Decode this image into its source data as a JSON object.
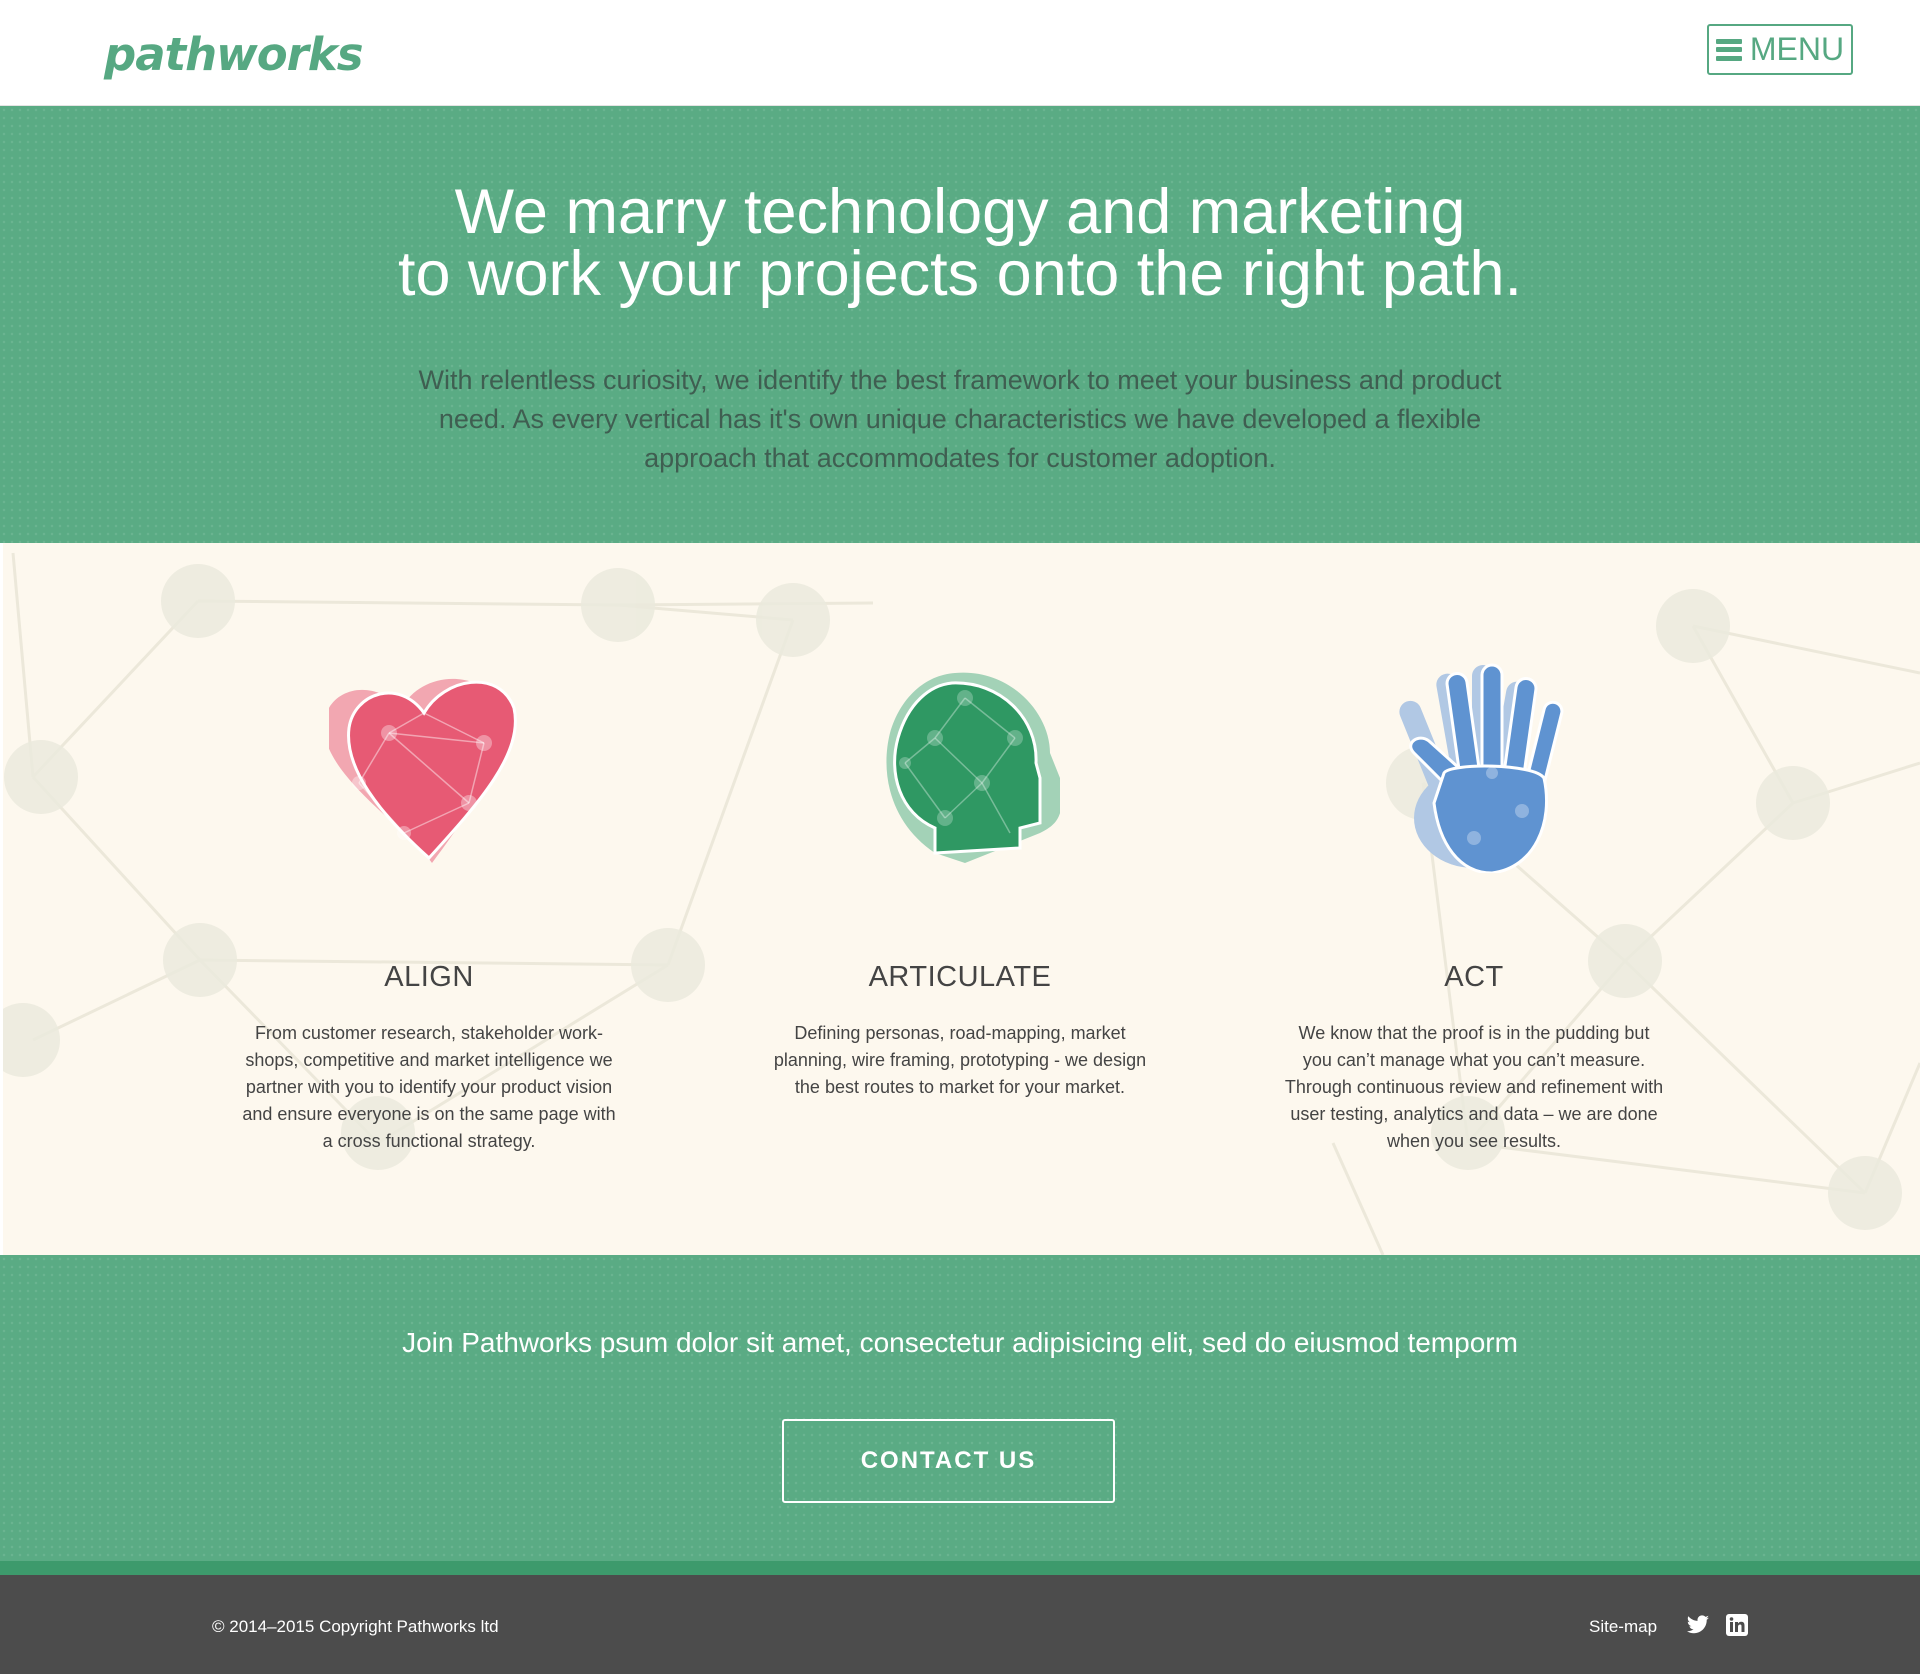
{
  "header": {
    "logo_text": "pathworks",
    "menu_label": "MENU"
  },
  "hero": {
    "title_line1": "We marry technology and marketing",
    "title_line2": "to work your projects onto the right path.",
    "text": "With relentless curiosity, we identify the best framework to meet your business  and product need. As every vertical has it's own unique characteristics we have developed a flexible approach that accommodates for customer adoption."
  },
  "features": [
    {
      "icon": "heart-icon",
      "title": "ALIGN",
      "text": "From customer research, stakeholder work-shops, competitive and market intelligence we partner with you to identify your product vision and ensure everyone is on the same page with a cross functional strategy."
    },
    {
      "icon": "head-icon",
      "title": "ARTICULATE",
      "text": "Defining personas, road-mapping, market planning, wire framing, prototyping - we design the best routes to market for your market."
    },
    {
      "icon": "hand-icon",
      "title": "ACT",
      "text": "We know that the proof is in the pudding but you can’t manage what you can’t measure.  Through continuous review and refinement with user testing, analytics and data – we are done when you see results."
    }
  ],
  "cta": {
    "text": "Join Pathworks psum dolor sit amet, consectetur adipisicing elit, sed do eiusmod temporm",
    "button_label": "CONTACT US"
  },
  "footer": {
    "copyright": "© 2014–2015 Copyright Pathworks ltd",
    "sitemap_label": "Site-map",
    "social": [
      "twitter-icon",
      "linkedin-icon"
    ]
  },
  "colors": {
    "brand_green": "#5aab84",
    "dark_green": "#3d9a6c",
    "heart": "#e75a74",
    "head": "#2f9863",
    "hand": "#5f93d1",
    "footer": "#4c4c4c",
    "features_bg": "#fdf8ee"
  }
}
